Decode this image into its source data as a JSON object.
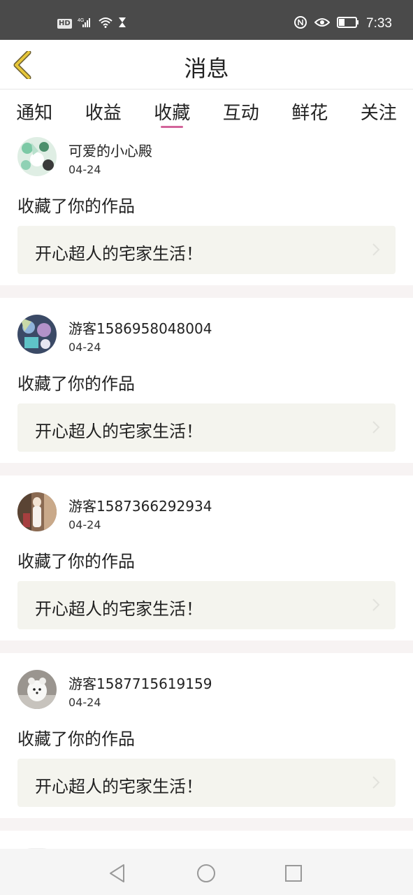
{
  "status_bar": {
    "hd": "HD",
    "network": "4G",
    "time": "7:33"
  },
  "header": {
    "title": "消息",
    "back_icon": "chevron-left-icon"
  },
  "tabs": [
    {
      "label": "通知",
      "active": false
    },
    {
      "label": "收益",
      "active": false
    },
    {
      "label": "收藏",
      "active": true
    },
    {
      "label": "互动",
      "active": false
    },
    {
      "label": "鲜花",
      "active": false
    },
    {
      "label": "关注",
      "active": false
    }
  ],
  "messages": [
    {
      "username": "可爱的小心殿",
      "date": "04-24",
      "action": "收藏了你的作品",
      "work_title": "开心超人的宅家生活！"
    },
    {
      "username": "游客1586958048004",
      "date": "04-24",
      "action": "收藏了你的作品",
      "work_title": "开心超人的宅家生活！"
    },
    {
      "username": "游客1587366292934",
      "date": "04-24",
      "action": "收藏了你的作品",
      "work_title": "开心超人的宅家生活！"
    },
    {
      "username": "游客1587715619159",
      "date": "04-24",
      "action": "收藏了你的作品",
      "work_title": "开心超人的宅家生活！"
    }
  ],
  "colors": {
    "accent": "#d2649a",
    "back_arrow": "#c9a227",
    "status_bar": "#4a4a4a",
    "card_link_bg": "#f4f4ee"
  }
}
